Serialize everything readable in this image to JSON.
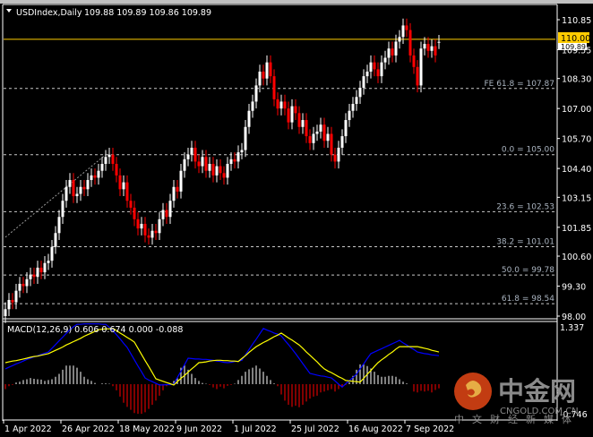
{
  "header": {
    "symbol_label": "USDIndex,Daily",
    "ohlc_text": "109.88 109.89 109.86 109.89",
    "menu_icon": "triangle-down-icon"
  },
  "colors": {
    "background": "#000000",
    "bull": "#ffffff",
    "bear": "#ff0000",
    "macd": "#0000ff",
    "signal": "#ffff00",
    "price_line": "#ffcc00",
    "grid_fib": "#c8c8c8"
  },
  "current_price": {
    "label": "110.00",
    "bid_label": "109.89"
  },
  "watermark": {
    "brand": "中金网",
    "domain": "CNGOLD.COM.CN",
    "tagline": "中文财经新媒体"
  },
  "chart_data": [
    {
      "type": "candlestick",
      "title": "USDIndex,Daily",
      "ylim": [
        98.0,
        110.85
      ],
      "yticks": [
        "110.85",
        "109.55",
        "108.30",
        "107.00",
        "105.70",
        "104.40",
        "103.15",
        "101.85",
        "100.60",
        "99.30",
        "98.00"
      ],
      "xticks": [
        {
          "index": 0,
          "label": "1 Apr 2022"
        },
        {
          "index": 16,
          "label": "26 Apr 2022"
        },
        {
          "index": 32,
          "label": "18 May 2022"
        },
        {
          "index": 48,
          "label": "9 Jun 2022"
        },
        {
          "index": 64,
          "label": "1 Jul 2022"
        },
        {
          "index": 80,
          "label": "25 Jul 2022"
        },
        {
          "index": 96,
          "label": "16 Aug 2022"
        },
        {
          "index": 112,
          "label": "7 Sep 2022"
        }
      ],
      "close": [
        98.3,
        98.7,
        98.6,
        99.1,
        99.4,
        99.3,
        99.6,
        99.8,
        99.7,
        100.1,
        99.9,
        100.3,
        100.4,
        101.0,
        101.6,
        102.3,
        103.0,
        103.6,
        103.9,
        103.2,
        103.3,
        103.6,
        103.5,
        103.9,
        104.1,
        104.0,
        104.3,
        104.6,
        104.9,
        105.0,
        104.6,
        104.1,
        103.5,
        103.8,
        103.0,
        102.7,
        102.2,
        101.8,
        102.0,
        101.5,
        101.4,
        101.7,
        101.6,
        102.2,
        102.6,
        102.3,
        103.0,
        103.6,
        103.4,
        104.3,
        104.8,
        105.0,
        105.3,
        104.7,
        104.5,
        104.9,
        104.3,
        104.6,
        104.1,
        104.5,
        104.2,
        104.0,
        104.6,
        104.8,
        104.7,
        105.1,
        105.2,
        106.2,
        106.9,
        107.3,
        108.0,
        108.6,
        108.3,
        109.0,
        108.4,
        107.4,
        107.0,
        107.3,
        107.0,
        106.4,
        107.1,
        106.8,
        106.2,
        106.5,
        105.8,
        105.5,
        105.9,
        106.0,
        106.3,
        105.6,
        105.9,
        105.0,
        104.7,
        105.3,
        105.8,
        106.5,
        106.9,
        107.2,
        107.5,
        107.9,
        108.4,
        108.6,
        109.0,
        108.7,
        108.4,
        109.0,
        109.2,
        109.6,
        109.3,
        109.9,
        110.1,
        110.6,
        110.4,
        109.3,
        108.8,
        108.0,
        109.6,
        109.8,
        109.5,
        109.7,
        109.3,
        109.89
      ],
      "open": [
        98.0,
        98.3,
        98.7,
        98.6,
        99.1,
        99.4,
        99.3,
        99.6,
        99.8,
        99.7,
        100.1,
        99.9,
        100.3,
        100.4,
        101.0,
        101.6,
        102.3,
        103.0,
        103.6,
        103.9,
        103.2,
        103.3,
        103.6,
        103.5,
        103.9,
        104.1,
        104.0,
        104.3,
        104.6,
        104.9,
        105.0,
        104.6,
        104.1,
        103.5,
        103.8,
        103.0,
        102.7,
        102.2,
        101.8,
        102.0,
        101.5,
        101.4,
        101.7,
        101.6,
        102.2,
        102.6,
        102.3,
        103.0,
        103.6,
        103.4,
        104.3,
        104.8,
        105.0,
        105.3,
        104.7,
        104.5,
        104.9,
        104.3,
        104.6,
        104.1,
        104.5,
        104.2,
        104.0,
        104.6,
        104.8,
        104.7,
        105.1,
        105.2,
        106.2,
        106.9,
        107.3,
        108.0,
        108.6,
        108.3,
        109.0,
        108.4,
        107.4,
        107.0,
        107.3,
        107.0,
        106.4,
        107.1,
        106.8,
        106.2,
        106.5,
        105.8,
        105.5,
        105.9,
        106.0,
        106.3,
        105.6,
        105.9,
        105.0,
        104.7,
        105.3,
        105.8,
        106.5,
        106.9,
        107.2,
        107.5,
        107.9,
        108.4,
        108.6,
        109.0,
        108.7,
        108.4,
        109.0,
        109.2,
        109.6,
        109.3,
        109.9,
        110.1,
        110.6,
        110.4,
        109.3,
        108.8,
        108.0,
        109.6,
        109.8,
        109.5,
        109.7,
        109.88
      ],
      "fibonacci": [
        {
          "label": "FE 61.8 = 107.87",
          "price": 107.87
        },
        {
          "label": "0.0 = 105.00",
          "price": 105.0
        },
        {
          "label": "23.6 = 102.53",
          "price": 102.53
        },
        {
          "label": "38.2 = 101.01",
          "price": 101.01
        },
        {
          "label": "50.0 = 99.78",
          "price": 99.78
        },
        {
          "label": "61.8 = 98.54",
          "price": 98.54
        }
      ],
      "trendline": {
        "from": {
          "index": 0,
          "price": 101.42
        },
        "to": {
          "index": 28,
          "price": 105.0
        }
      },
      "horizontal_line": 110.0
    },
    {
      "type": "indicator",
      "title": "MACD(12,26,9) 0.606 0.674 0.000 -0.088",
      "ylim": [
        -0.746,
        1.337
      ],
      "yticks": [
        "1.337",
        "-0.746"
      ],
      "macd": [
        0.37,
        0.41,
        0.45,
        0.49,
        0.52,
        0.56,
        0.6,
        0.63,
        0.66,
        0.69,
        0.72,
        0.75,
        0.78,
        0.87,
        0.96,
        1.05,
        1.14,
        1.23,
        1.32,
        1.39,
        1.45,
        1.45,
        1.46,
        1.46,
        1.46,
        1.46,
        1.46,
        1.45,
        1.45,
        1.38,
        1.3,
        1.2,
        1.1,
        0.99,
        0.89,
        0.74,
        0.59,
        0.44,
        0.3,
        0.15,
        0.1,
        0.06,
        0.02,
        -0.02,
        -0.02,
        -0.01,
        -0.01,
        0.0,
        0.16,
        0.31,
        0.47,
        0.63,
        0.62,
        0.61,
        0.61,
        0.6,
        0.6,
        0.59,
        0.58,
        0.56,
        0.55,
        0.53,
        0.52,
        0.53,
        0.55,
        0.56,
        0.58,
        0.71,
        0.84,
        0.97,
        1.09,
        1.22,
        1.35,
        1.31,
        1.28,
        1.24,
        1.21,
        1.17,
        1.06,
        0.96,
        0.85,
        0.74,
        0.62,
        0.5,
        0.38,
        0.26,
        0.24,
        0.22,
        0.2,
        0.19,
        0.17,
        0.15,
        0.08,
        0.0,
        -0.07,
        0.01,
        0.09,
        0.16,
        0.24,
        0.37,
        0.49,
        0.62,
        0.74,
        0.78,
        0.82,
        0.86,
        0.9,
        0.94,
        0.98,
        1.02,
        1.06,
        1.0,
        0.95,
        0.89,
        0.84,
        0.78,
        0.76,
        0.74,
        0.73,
        0.71,
        0.7,
        0.69
      ],
      "signal": [
        0.52,
        0.54,
        0.56,
        0.57,
        0.59,
        0.61,
        0.63,
        0.65,
        0.67,
        0.68,
        0.7,
        0.72,
        0.74,
        0.78,
        0.82,
        0.86,
        0.9,
        0.95,
        0.99,
        1.03,
        1.07,
        1.11,
        1.16,
        1.2,
        1.24,
        1.28,
        1.32,
        1.33,
        1.34,
        1.34,
        1.35,
        1.3,
        1.24,
        1.19,
        1.13,
        1.08,
        1.02,
        0.87,
        0.72,
        0.57,
        0.43,
        0.28,
        0.13,
        0.1,
        0.07,
        0.04,
        0.01,
        -0.02,
        0.06,
        0.14,
        0.21,
        0.29,
        0.37,
        0.44,
        0.52,
        0.53,
        0.54,
        0.56,
        0.57,
        0.58,
        0.58,
        0.57,
        0.57,
        0.56,
        0.56,
        0.55,
        0.62,
        0.69,
        0.77,
        0.84,
        0.91,
        0.96,
        1.01,
        1.05,
        1.1,
        1.15,
        1.19,
        1.24,
        1.18,
        1.12,
        1.07,
        1.01,
        0.95,
        0.87,
        0.78,
        0.7,
        0.62,
        0.54,
        0.45,
        0.37,
        0.32,
        0.28,
        0.23,
        0.18,
        0.14,
        0.09,
        0.08,
        0.07,
        0.06,
        0.05,
        0.14,
        0.24,
        0.33,
        0.43,
        0.52,
        0.59,
        0.65,
        0.72,
        0.78,
        0.85,
        0.91,
        0.91,
        0.91,
        0.91,
        0.91,
        0.91,
        0.89,
        0.87,
        0.85,
        0.82,
        0.8,
        0.78
      ],
      "histogram": [
        -0.12,
        -0.05,
        -0.02,
        0.04,
        0.06,
        0.1,
        0.12,
        0.15,
        0.13,
        0.12,
        0.11,
        0.08,
        0.1,
        0.12,
        0.18,
        0.25,
        0.35,
        0.45,
        0.45,
        0.45,
        0.4,
        0.3,
        0.18,
        0.12,
        0.08,
        0.03,
        0.0,
        0.02,
        0.02,
        0.01,
        -0.05,
        -0.15,
        -0.3,
        -0.45,
        -0.55,
        -0.62,
        -0.7,
        -0.72,
        -0.72,
        -0.68,
        -0.6,
        -0.5,
        -0.4,
        -0.28,
        -0.15,
        -0.05,
        0.0,
        0.08,
        0.15,
        0.4,
        0.48,
        0.35,
        0.25,
        0.15,
        0.08,
        0.03,
        0.01,
        -0.02,
        -0.08,
        -0.12,
        -0.06,
        -0.1,
        -0.04,
        -0.02,
        0.01,
        0.1,
        0.2,
        0.3,
        0.36,
        0.4,
        0.45,
        0.38,
        0.3,
        0.2,
        0.1,
        0.02,
        -0.05,
        -0.25,
        -0.4,
        -0.5,
        -0.55,
        -0.52,
        -0.56,
        -0.5,
        -0.42,
        -0.35,
        -0.3,
        -0.28,
        -0.2,
        -0.18,
        -0.15,
        -0.12,
        -0.18,
        -0.12,
        -0.08,
        -0.02,
        0.05,
        0.2,
        0.35,
        0.48,
        0.48,
        0.44,
        0.38,
        0.3,
        0.22,
        0.18,
        0.18,
        0.2,
        0.2,
        0.18,
        0.12,
        0.06,
        0.02,
        0.0,
        -0.18,
        -0.2,
        -0.16,
        -0.18,
        -0.16,
        -0.2,
        -0.14,
        -0.1
      ]
    }
  ]
}
